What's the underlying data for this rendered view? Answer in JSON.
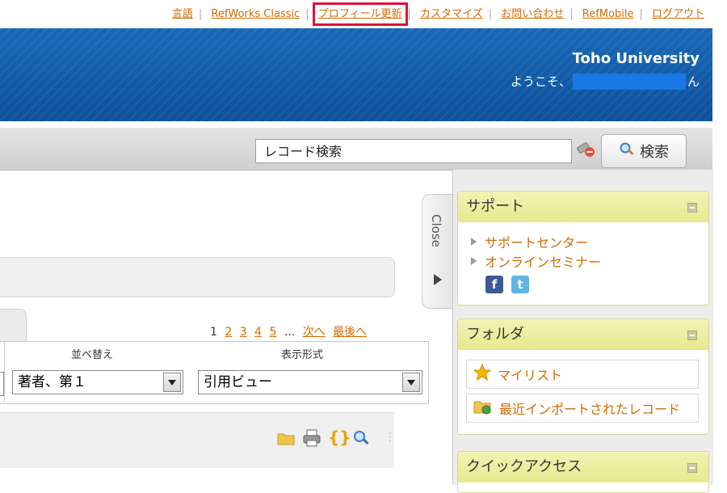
{
  "top_links": {
    "language": "言語",
    "refworks_classic": "RefWorks Classic",
    "profile_update": "プロフィール更新",
    "customize": "カスタマイズ",
    "contact": "お問い合わせ",
    "refmobile": "RefMobile",
    "logout": "ログアウト",
    "separator": "|"
  },
  "header": {
    "institution": "Toho University",
    "welcome_prefix": "ようこそ、",
    "welcome_suffix": "ん"
  },
  "search": {
    "value": "レコード検索",
    "button_label": "検索"
  },
  "pager": {
    "current": "1",
    "pages": [
      "2",
      "3",
      "4",
      "5"
    ],
    "ellipsis": "...",
    "next": "次へ",
    "last": "最後へ"
  },
  "controls": {
    "sort_label": "並べ替え",
    "sort_value": "著者、第１",
    "view_label": "表示形式",
    "view_value": "引用ビュー"
  },
  "close_tab": {
    "label": "Close"
  },
  "support_panel": {
    "title": "サポート",
    "items": [
      "サポートセンター",
      "オンラインセミナー"
    ],
    "social": [
      "facebook-icon",
      "twitter-icon"
    ]
  },
  "folder_panel": {
    "title": "フォルダ",
    "items": [
      "マイリスト",
      "最近インポートされたレコード"
    ]
  },
  "quick_access_panel": {
    "title": "クイックアクセス"
  },
  "colors": {
    "link": "#d06a00",
    "banner": "#0b4f99",
    "highlight": "#e0103a",
    "panel_header": "#e6e98e"
  }
}
